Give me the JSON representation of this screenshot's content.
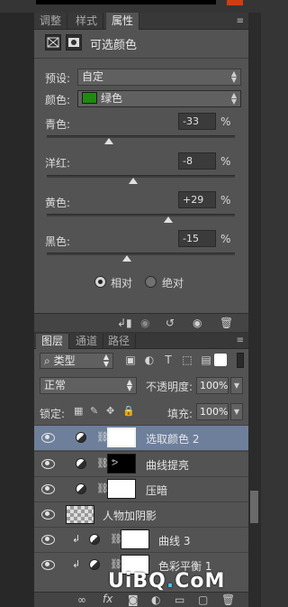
{
  "properties_panel": {
    "tabs": [
      "调整",
      "样式",
      "属性"
    ],
    "active_tab": "属性",
    "title": "可选颜色",
    "preset_label": "预设:",
    "preset_value": "自定",
    "color_label": "颜色:",
    "color_value": "绿色",
    "swatch_color": "#1f8a0f",
    "sliders": [
      {
        "label": "青色:",
        "value": "-33",
        "unit": "%",
        "position": 0.33
      },
      {
        "label": "洋红:",
        "value": "-8",
        "unit": "%",
        "position": 0.46
      },
      {
        "label": "黄色:",
        "value": "+29",
        "unit": "%",
        "position": 0.645
      },
      {
        "label": "黑色:",
        "value": "-15",
        "unit": "%",
        "position": 0.425
      }
    ],
    "radio_relative": "相对",
    "radio_absolute": "绝对",
    "selected_method": "相对"
  },
  "layers_panel": {
    "tabs": [
      "图层",
      "通道",
      "路径"
    ],
    "active_tab": "图层",
    "filter_kind": "类型",
    "blend_mode": "正常",
    "opacity_label": "不透明度:",
    "opacity_value": "100%",
    "lock_label": "锁定:",
    "fill_label": "填充:",
    "fill_value": "100%",
    "layers": [
      {
        "name": "选取颜色 2",
        "selected": true
      },
      {
        "name": "曲线提亮",
        "selected": false
      },
      {
        "name": "压暗",
        "selected": false
      },
      {
        "name": "人物加阴影",
        "selected": false
      },
      {
        "name": "曲线 3",
        "selected": false
      },
      {
        "name": "色彩平衡 1",
        "selected": false
      }
    ]
  },
  "watermark": {
    "text_main": "UiBQ",
    "text_dot": ".",
    "text_tail": "CoM"
  },
  "colors": {
    "panel_bg": "#535353",
    "selected_row": "#6d7f9b",
    "watermark_accent": "#46c1ea"
  }
}
